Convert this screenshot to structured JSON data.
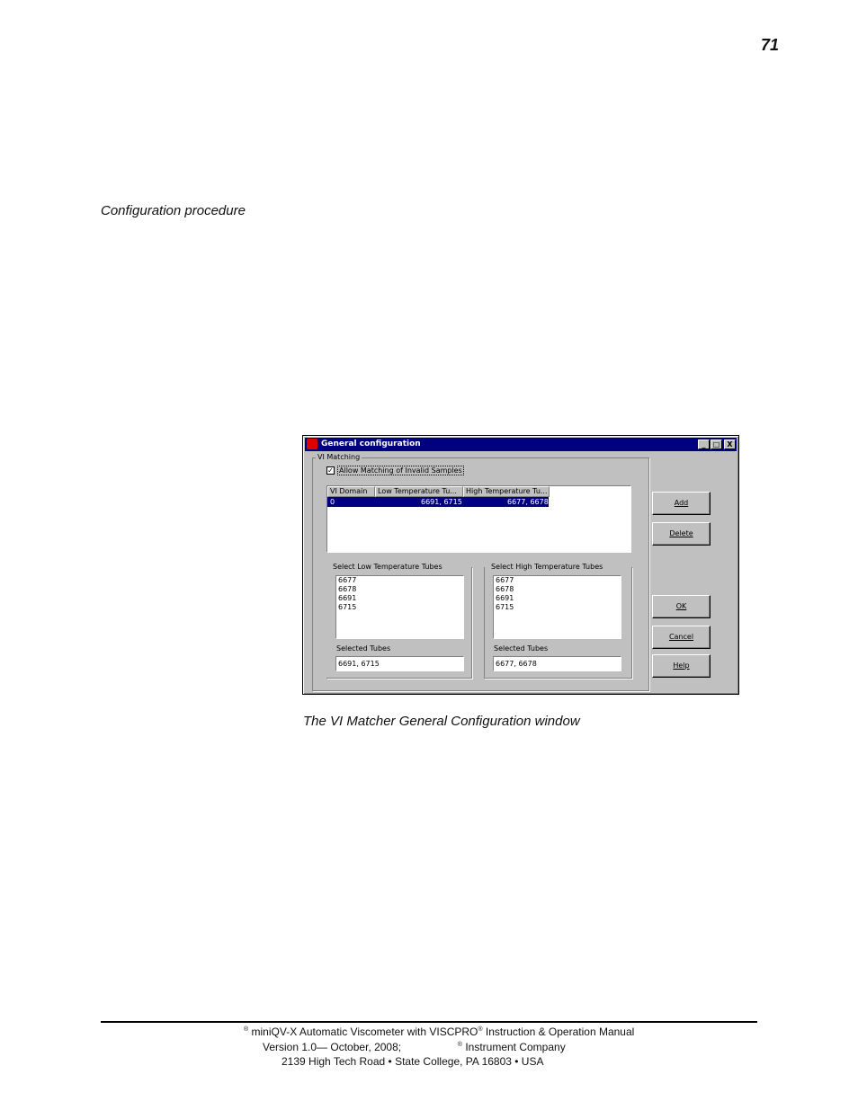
{
  "page_number": "71",
  "section_heading": "Configuration procedure",
  "dialog": {
    "title": "General configuration",
    "titlebar_buttons": [
      "_",
      "□",
      "X"
    ],
    "group_label": "VI Matching",
    "checkbox_label": "Allow Matching of Invalid Samples",
    "checkbox_checked": true,
    "list_columns": [
      "VI Domain",
      "Low Temperature Tu...",
      "High Temperature Tu..."
    ],
    "list_rows": [
      {
        "domain": "0",
        "low": "6691, 6715",
        "high": "6677, 6678",
        "selected": true
      }
    ],
    "low_group_label": "Select Low Temperature Tubes",
    "high_group_label": "Select High Temperature Tubes",
    "low_tubes": [
      "6677",
      "6678",
      "6691",
      "6715"
    ],
    "high_tubes": [
      "6677",
      "6678",
      "6691",
      "6715"
    ],
    "selected_tubes_label": "Selected Tubes",
    "low_selected_value": "6691, 6715",
    "high_selected_value": "6677, 6678",
    "buttons": {
      "add": "Add",
      "delete": "Delete",
      "ok": "OK",
      "cancel": "Cancel",
      "help": "Help"
    }
  },
  "caption": "The VI Matcher General Configuration window",
  "footer": {
    "line1_mark": "®",
    "line1_a": "miniQV-X Automatic Viscometer with VISCPRO",
    "line1_b": "Instruction & Operation Manual",
    "line2_a": "Version 1.0— October, 2008;",
    "line2_b": "Instrument Company",
    "line3": "2139 High Tech Road • State College, PA  16803 • USA"
  }
}
